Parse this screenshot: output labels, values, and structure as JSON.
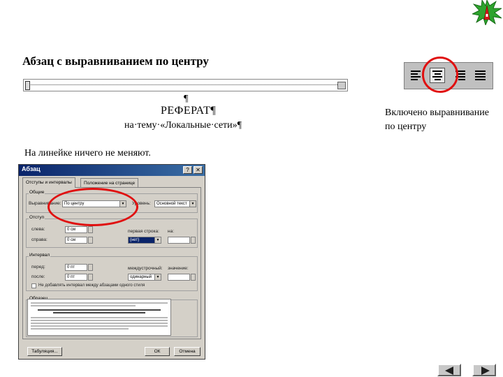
{
  "slide": {
    "title": "Абзац с выравниванием по центру",
    "document": {
      "pilcrow": "¶",
      "line1": "РЕФЕРАТ¶",
      "line2": "на·тему·«Локальные·сети»¶"
    },
    "note_left": "На линейке ничего не меняют.",
    "note_right": "Включено выравнивание по центру"
  },
  "toolbar": {
    "buttons": [
      {
        "icon": "align-left-icon",
        "pressed": false
      },
      {
        "icon": "align-center-icon",
        "pressed": true
      },
      {
        "icon": "align-right-icon",
        "pressed": false
      },
      {
        "icon": "align-justify-icon",
        "pressed": false
      }
    ]
  },
  "dialog": {
    "title": "Абзац",
    "help_btn": "?",
    "close_btn": "✕",
    "tabs": [
      "Отступы и интервалы",
      "Положение на странице"
    ],
    "general": {
      "group": "Общие",
      "align_label": "Выравнивание:",
      "align_value": "По центру",
      "level_label": "Уровень:",
      "level_value": "Основной текст"
    },
    "indent": {
      "group": "Отступ",
      "left_label": "слева:",
      "left_value": "0 см",
      "right_label": "справа:",
      "right_value": "0 см",
      "first_line_label": "первая строка:",
      "first_line_value": "(нет)",
      "by_label": "на:"
    },
    "spacing": {
      "group": "Интервал",
      "before_label": "перед:",
      "before_value": "0 пт",
      "after_label": "после:",
      "after_value": "0 пт",
      "line_label": "междустрочный:",
      "line_value": "одинарный",
      "value_label": "значение:"
    },
    "checkbox_label": "Не добавлять интервал между абзацами одного стиля",
    "sample_group": "Образец",
    "buttons": {
      "tabs": "Табуляция...",
      "ok": "ОК",
      "cancel": "Отмена"
    }
  },
  "colors": {
    "highlight_circle": "#e01010",
    "titlebar": "#0a246a",
    "dialog_bg": "#d4d0c8"
  }
}
